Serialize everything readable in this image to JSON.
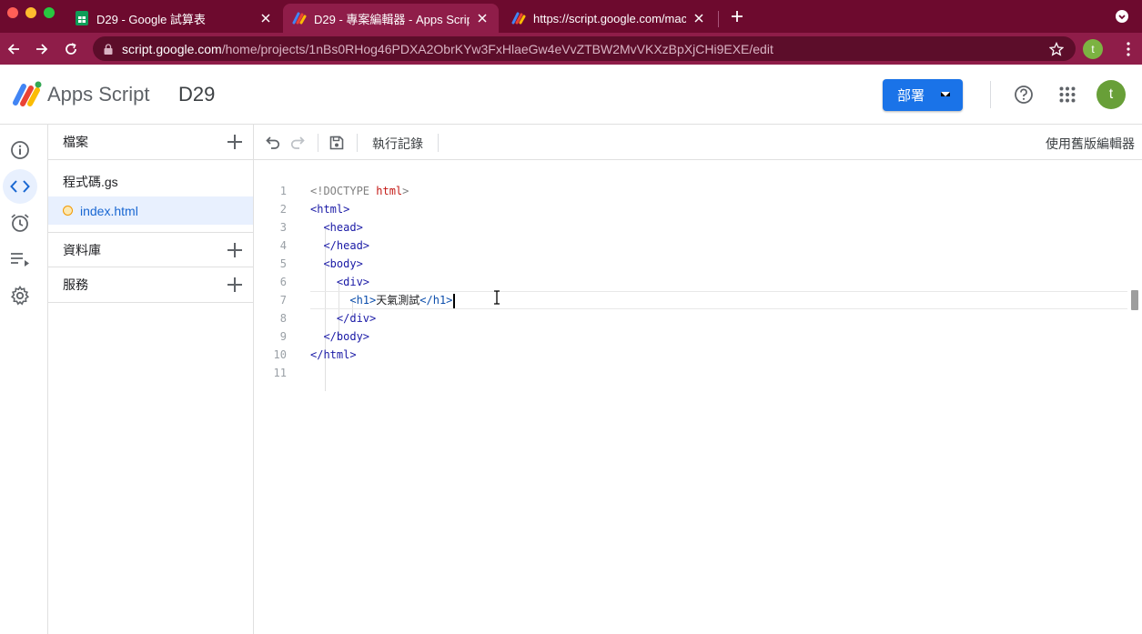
{
  "browser": {
    "tabs": [
      {
        "title": "D29 - Google 試算表",
        "active": false,
        "favicon": "sheets-icon"
      },
      {
        "title": "D29 - 專案編輯器 - Apps Script",
        "active": true,
        "favicon": "apps-script-icon"
      },
      {
        "title": "https://script.google.com/macr",
        "active": false,
        "favicon": "apps-script-icon"
      }
    ],
    "url_host": "script.google.com",
    "url_path": "/home/projects/1nBs0RHog46PDXA2ObrKYw3FxHlaeGw4eVvZTBW2MvVKXzBpXjCHi9EXE/edit",
    "profile_initial": "t"
  },
  "app": {
    "name": "Apps Script",
    "project": "D29",
    "deploy_label": "部署",
    "avatar_initial": "t"
  },
  "files_panel": {
    "files_header": "檔案",
    "files": [
      {
        "name": "程式碼.gs",
        "active": false
      },
      {
        "name": "index.html",
        "active": true
      }
    ],
    "libraries_header": "資料庫",
    "services_header": "服務"
  },
  "editor_toolbar": {
    "exec_log": "執行記錄",
    "legacy_editor": "使用舊版編輯器"
  },
  "editor": {
    "line_numbers": [
      "1",
      "2",
      "3",
      "4",
      "5",
      "6",
      "7",
      "8",
      "9",
      "10",
      "11"
    ],
    "lines": [
      "<!DOCTYPE html>",
      "<html>",
      "  <head>",
      "  </head>",
      "  <body>",
      "    <div>",
      "      <h1>天氣測試</h1>",
      "    </div>",
      "  </body>",
      "</html>",
      ""
    ]
  },
  "colors": {
    "tabstrip": "#6d0a2e",
    "toolbar": "#8f1d49",
    "accent": "#1a73e8"
  }
}
